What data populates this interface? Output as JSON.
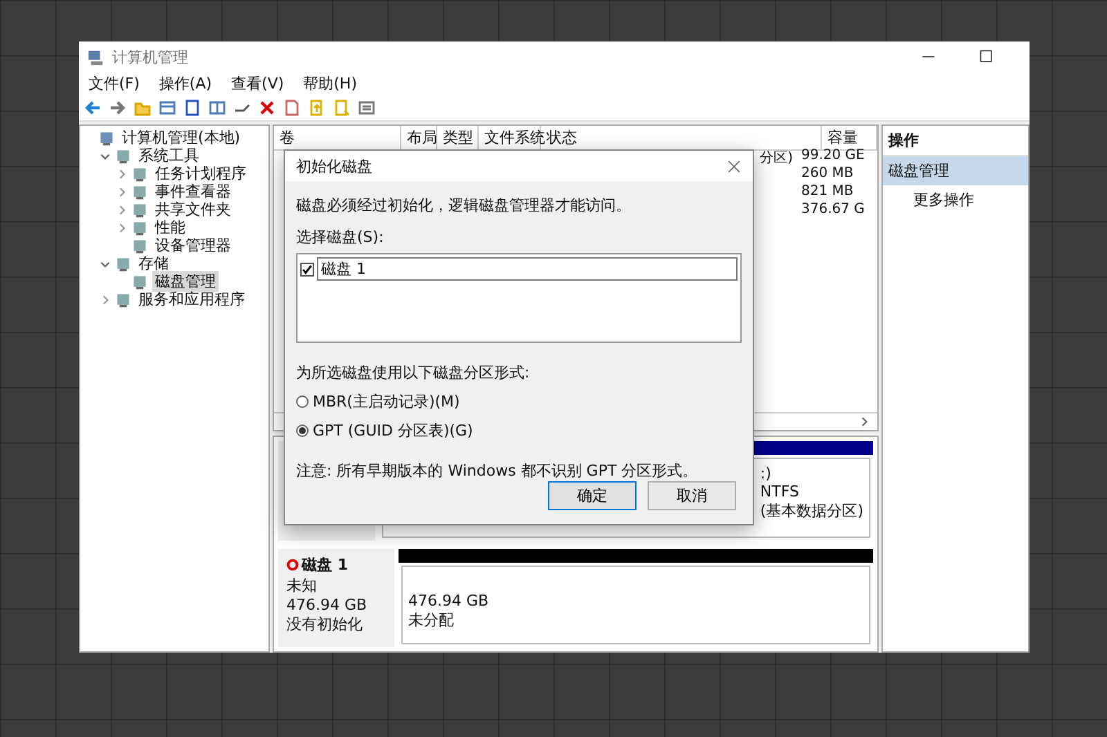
{
  "window": {
    "title": "计算机管理"
  },
  "menu": [
    "文件(F)",
    "操作(A)",
    "查看(V)",
    "帮助(H)"
  ],
  "tree": [
    {
      "label": "计算机管理(本地)",
      "selected": false,
      "children": [
        {
          "label": "系统工具",
          "expanded": true,
          "selected": false,
          "children": [
            {
              "label": "任务计划程序",
              "expanded": false,
              "selected": false
            },
            {
              "label": "事件查看器",
              "expanded": false,
              "selected": false
            },
            {
              "label": "共享文件夹",
              "expanded": false,
              "selected": false
            },
            {
              "label": "性能",
              "expanded": false,
              "selected": false
            },
            {
              "label": "设备管理器",
              "selected": false
            }
          ]
        },
        {
          "label": "存储",
          "expanded": true,
          "selected": false,
          "children": [
            {
              "label": "磁盘管理",
              "selected": true
            }
          ]
        },
        {
          "label": "服务和应用程序",
          "expanded": false,
          "selected": false
        }
      ]
    }
  ],
  "table": {
    "columns": [
      "卷",
      "布局",
      "类型",
      "文件系统",
      "状态",
      "容量"
    ],
    "rows": [
      {
        "status": "分区)",
        "capacity": "99.20 GE"
      },
      {
        "capacity": "260 MB"
      },
      {
        "capacity": "821 MB"
      },
      {
        "capacity": "376.67 G"
      }
    ]
  },
  "disks": [
    {
      "partitions_text": [
        ":)",
        "NTFS",
        "(基本数据分区)"
      ]
    },
    {
      "name": "磁盘 1",
      "lines": [
        "未知",
        "476.94 GB",
        "没有初始化"
      ],
      "partitions_text": [
        "476.94 GB",
        "未分配"
      ]
    }
  ],
  "actions": {
    "header": "操作",
    "items": [
      {
        "label": "磁盘管理",
        "kind": "heading",
        "selected": true
      },
      {
        "label": "更多操作",
        "kind": "action",
        "selected": false
      }
    ]
  },
  "dialog": {
    "title": "初始化磁盘",
    "message": "磁盘必须经过初始化，逻辑磁盘管理器才能访问。",
    "select_label": "选择磁盘(S):",
    "disks": [
      {
        "label": "磁盘 1",
        "checked": true
      }
    ],
    "format_label": "为所选磁盘使用以下磁盘分区形式:",
    "options": [
      {
        "label": "MBR(主启动记录)(M)",
        "selected": false
      },
      {
        "label": "GPT (GUID 分区表)(G)",
        "selected": true
      }
    ],
    "note": "注意: 所有早期版本的 Windows 都不识别 GPT 分区形式。",
    "buttons": [
      {
        "label": "确定",
        "default": true
      },
      {
        "label": "取消",
        "default": false
      }
    ]
  }
}
